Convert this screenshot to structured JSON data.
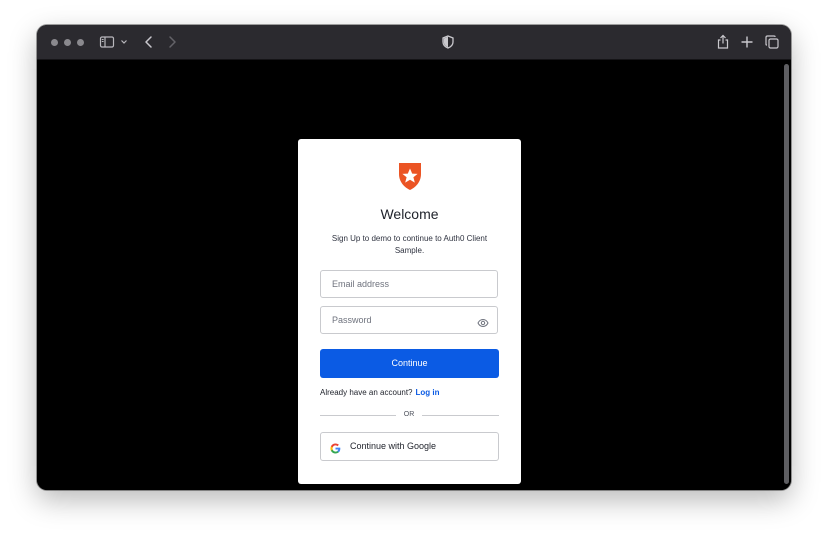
{
  "browser": {
    "window_controls": [
      "close",
      "minimize",
      "zoom"
    ],
    "toolbar_icons": [
      "sidebar-icon",
      "chevron-down-icon",
      "back-icon",
      "forward-icon",
      "shield-icon",
      "share-icon",
      "plus-icon",
      "tabs-overview-icon"
    ]
  },
  "login": {
    "title": "Welcome",
    "subtitle": "Sign Up to demo to continue to Auth0 Client Sample.",
    "email_placeholder": "Email address",
    "password_placeholder": "Password",
    "continue_label": "Continue",
    "already_text": "Already have an account?",
    "login_link": "Log in",
    "or_text": "OR",
    "google_label": "Continue with Google"
  },
  "colors": {
    "brand": "#eb5424",
    "primary": "#0b5be4",
    "page_background": "#000000",
    "card": "#ffffff"
  }
}
